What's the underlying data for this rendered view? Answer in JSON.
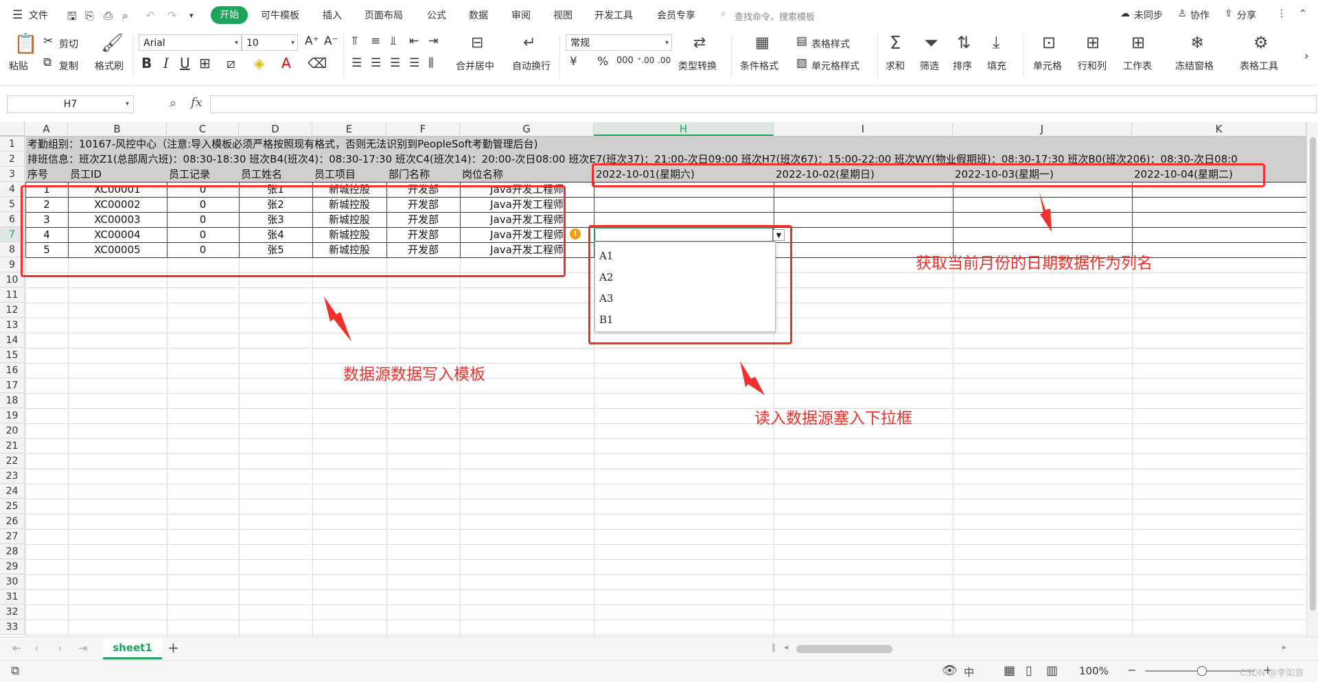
{
  "menubar": {
    "file": "文件",
    "tabs": [
      "开始",
      "可牛模板",
      "插入",
      "页面布局",
      "公式",
      "数据",
      "审阅",
      "视图",
      "开发工具",
      "会员专享"
    ],
    "search_placeholder": "查找命令、搜索模板",
    "sync": "未同步",
    "collab": "协作",
    "share": "分享"
  },
  "ribbon": {
    "paste": "粘贴",
    "cut": "剪切",
    "copy": "复制",
    "format_painter": "格式刷",
    "font_name": "Arial",
    "font_size": "10",
    "merge": "合并居中",
    "wrap": "自动换行",
    "number_format": "常规",
    "type_convert": "类型转换",
    "cond_format": "条件格式",
    "table_style": "表格样式",
    "cell_style": "单元格样式",
    "sum": "求和",
    "filter": "筛选",
    "sort": "排序",
    "fill": "填充",
    "cell": "单元格",
    "rowcol": "行和列",
    "worksheet": "工作表",
    "freeze": "冻结窗格",
    "table_tools": "表格工具"
  },
  "formula_bar": {
    "name_box": "H7",
    "fx": "fx",
    "content": ""
  },
  "columns": [
    "A",
    "B",
    "C",
    "D",
    "E",
    "F",
    "G",
    "H",
    "I",
    "J",
    "K"
  ],
  "rows": [
    "1",
    "2",
    "3",
    "4",
    "5",
    "6",
    "7",
    "8",
    "9",
    "10",
    "11",
    "12",
    "13",
    "14",
    "15",
    "16",
    "17",
    "18",
    "19",
    "20",
    "21",
    "22",
    "23",
    "24",
    "25",
    "26",
    "27",
    "28",
    "29",
    "30",
    "31",
    "32",
    "33"
  ],
  "sheet": {
    "row1": "考勤组别：10167-风控中心（注意:导入模板必须严格按照现有格式，否则无法识别到PeopleSoft考勤管理后台)",
    "row2": "排班信息：班次Z1(总部周六班)：08:30-18:30  班次B4(班次4)：08:30-17:30  班次C4(班次14)：20:00-次日08:00  班次E7(班次37)：21:00-次日09:00  班次H7(班次67)：15:00-22:00 班次WY(物业假期班)：08:30-17:30  班次B0(班次206)：08:30-次日08:0",
    "headers": [
      "序号",
      "员工ID",
      "员工记录",
      "员工姓名",
      "员工项目",
      "部门名称",
      "岗位名称",
      "2022-10-01(星期六)",
      "2022-10-02(星期日)",
      "2022-10-03(星期一)",
      "2022-10-04(星期二)"
    ],
    "data": [
      [
        "1",
        "XC00001",
        "0",
        "张1",
        "新城控股",
        "开发部",
        "Java开发工程师"
      ],
      [
        "2",
        "XC00002",
        "0",
        "张2",
        "新城控股",
        "开发部",
        "Java开发工程师"
      ],
      [
        "3",
        "XC00003",
        "0",
        "张3",
        "新城控股",
        "开发部",
        "Java开发工程师"
      ],
      [
        "4",
        "XC00004",
        "0",
        "张4",
        "新城控股",
        "开发部",
        "Java开发工程师"
      ],
      [
        "5",
        "XC00005",
        "0",
        "张5",
        "新城控股",
        "开发部",
        "Java开发工程师"
      ]
    ]
  },
  "dropdown": {
    "options": [
      "A1",
      "A2",
      "A3",
      "B1"
    ]
  },
  "annotations": {
    "a1": "获取当前月份的日期数据作为列名",
    "a2": "数据源数据写入模板",
    "a3": "读入数据源塞入下拉框"
  },
  "sheet_tab": "sheet1",
  "status": {
    "zoom": "100%",
    "ime": "中",
    "watermark": "CSDN @李如意"
  },
  "colors": {
    "accent": "#1ca35c",
    "annotation": "#f0302a",
    "header_gray": "#cfcfcf"
  }
}
